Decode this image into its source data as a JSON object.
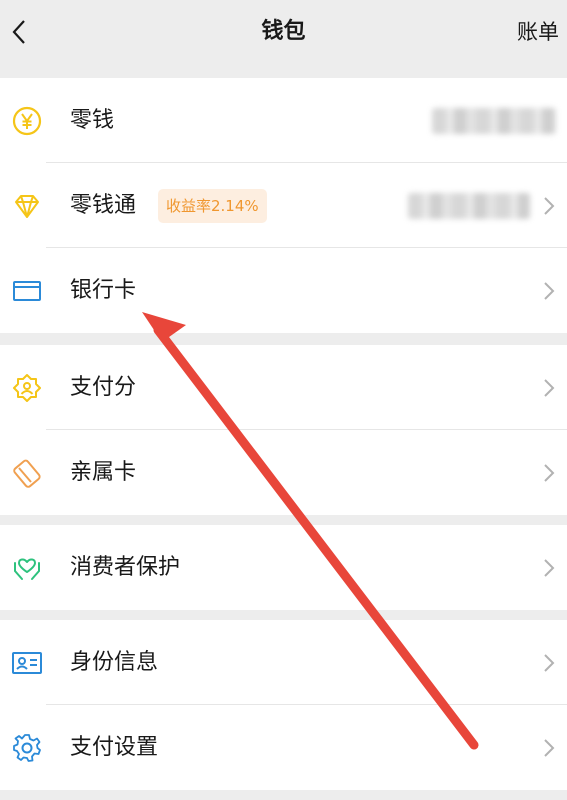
{
  "header": {
    "title": "钱包",
    "bill_label": "账单"
  },
  "groups": [
    {
      "items": [
        {
          "label": "零钱",
          "icon": "yen-coin-icon"
        },
        {
          "label": "零钱通",
          "icon": "diamond-icon",
          "badge": "收益率2.14%"
        },
        {
          "label": "银行卡",
          "icon": "bank-card-icon"
        }
      ]
    },
    {
      "items": [
        {
          "label": "支付分",
          "icon": "pay-score-icon"
        },
        {
          "label": "亲属卡",
          "icon": "family-card-icon"
        }
      ]
    },
    {
      "items": [
        {
          "label": "消费者保护",
          "icon": "consumer-protection-icon"
        }
      ]
    },
    {
      "items": [
        {
          "label": "身份信息",
          "icon": "id-card-icon"
        },
        {
          "label": "支付设置",
          "icon": "settings-gear-icon"
        }
      ]
    }
  ],
  "colors": {
    "yellow_icon": "#f5c518",
    "orange_icon": "#f0a050",
    "blue_icon": "#2b8ad8",
    "green_icon": "#2ec27e",
    "badge_text": "#f0972f",
    "badge_bg": "#fdeee0",
    "annotation_arrow": "#e8463a"
  }
}
